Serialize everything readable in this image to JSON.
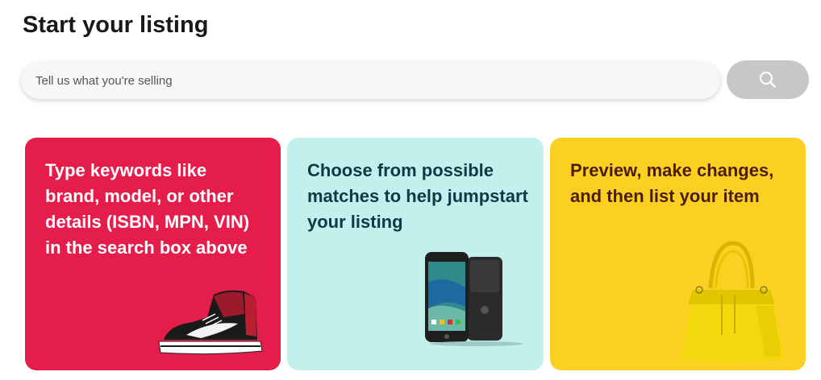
{
  "header": {
    "title": "Start your listing"
  },
  "search": {
    "placeholder": "Tell us what you're selling",
    "value": "",
    "button_icon": "search-icon"
  },
  "cards": [
    {
      "text": "Type keywords like brand, model, or other details (ISBN, MPN, VIN) in the search box above",
      "image": "sneaker",
      "color": "#e51d4b"
    },
    {
      "text": "Choose from possible matches to help jumpstart your listing",
      "image": "smartphones",
      "color": "#c3f0ed"
    },
    {
      "text": "Preview, make changes, and then list your item",
      "image": "yellow-handbag",
      "color": "#fcd023"
    }
  ],
  "colors": {
    "search_button": "#c7c7c7",
    "search_bar": "#f7f7f7"
  }
}
